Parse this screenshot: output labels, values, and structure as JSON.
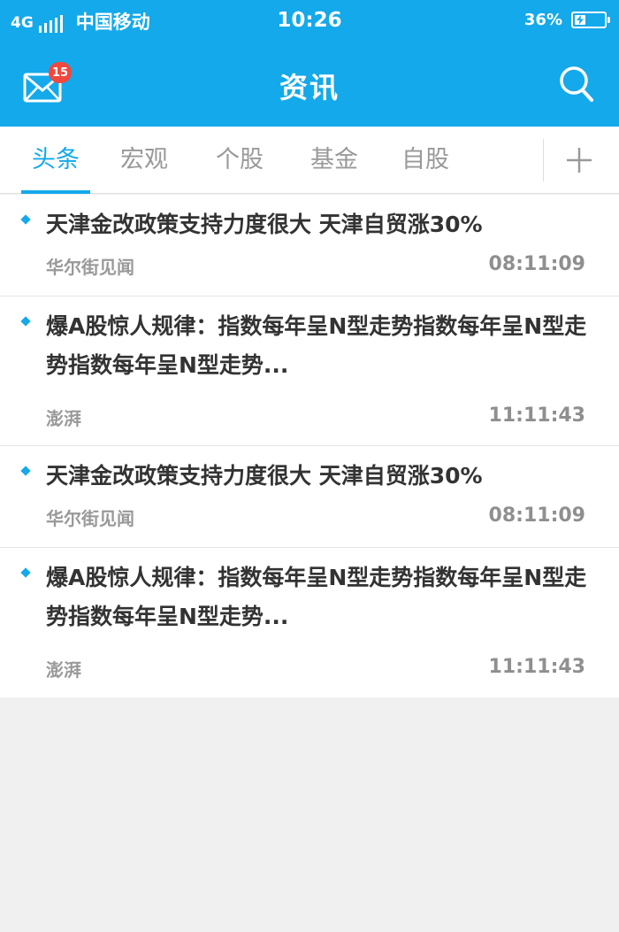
{
  "status_bar": {
    "network": "4G",
    "carrier": "中国移动",
    "time": "10:26",
    "battery_percent": "36%",
    "battery_level": 0.36
  },
  "nav": {
    "title": "资讯",
    "mail_badge": "15",
    "icons": {
      "mail": "mail-icon",
      "search": "search-icon"
    }
  },
  "tabs": [
    {
      "label": "头条",
      "active": true
    },
    {
      "label": "宏观",
      "active": false
    },
    {
      "label": "个股",
      "active": false
    },
    {
      "label": "基金",
      "active": false
    },
    {
      "label": "自股",
      "active": false
    }
  ],
  "news": [
    {
      "title": "天津金改政策支持力度很大 天津自贸涨30%",
      "source": "华尔街见闻",
      "time": "08:11:09"
    },
    {
      "title": "爆A股惊人规律：指数每年呈N型走势指数每年呈N型走势指数每年呈N型走势...",
      "source": "澎湃",
      "time": "11:11:43"
    },
    {
      "title": "天津金改政策支持力度很大 天津自贸涨30%",
      "source": "华尔街见闻",
      "time": "08:11:09"
    },
    {
      "title": "爆A股惊人规律：指数每年呈N型走势指数每年呈N型走势指数每年呈N型走势...",
      "source": "澎湃",
      "time": "11:11:43"
    }
  ],
  "colors": {
    "accent": "#14a9ea",
    "badge": "#f0483e",
    "title_text": "#333333",
    "meta_text": "#999999",
    "page_bg": "#f0f0f0"
  }
}
